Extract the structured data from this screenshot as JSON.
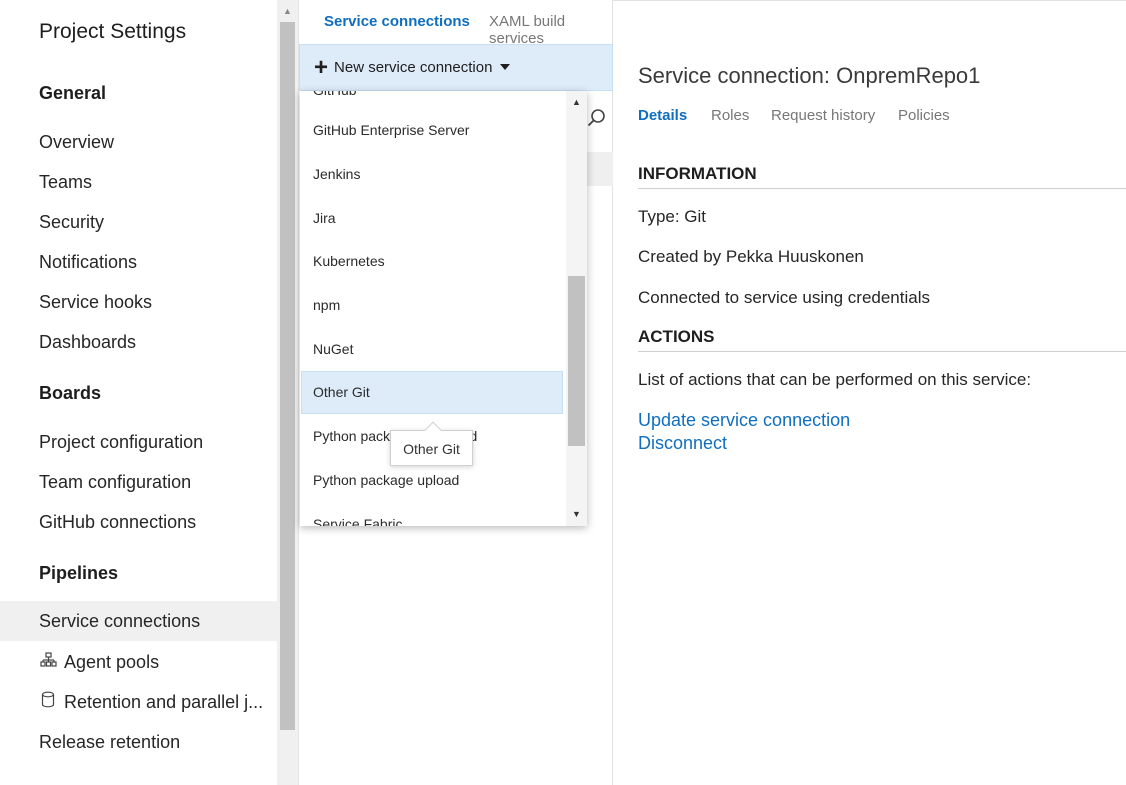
{
  "left_nav": {
    "title": "Project Settings",
    "sections": {
      "general": "General",
      "boards": "Boards",
      "pipelines": "Pipelines"
    },
    "general_items": [
      "Overview",
      "Teams",
      "Security",
      "Notifications",
      "Service hooks",
      "Dashboards"
    ],
    "boards_items": [
      "Project configuration",
      "Team configuration",
      "GitHub connections"
    ],
    "pipelines_items": [
      "Service connections",
      "Agent pools",
      "Retention and parallel j...",
      "Release retention"
    ],
    "selected_item": "Service connections"
  },
  "top_tabs": {
    "service_connections": "Service connections",
    "xaml": "XAML build services"
  },
  "new_button": {
    "label": "New service connection"
  },
  "dropdown": {
    "items": [
      "GitHub",
      "GitHub Enterprise Server",
      "Jenkins",
      "Jira",
      "Kubernetes",
      "npm",
      "NuGet",
      "Other Git",
      "Python package download",
      "Python package upload",
      "Service Fabric"
    ],
    "hovered": "Other Git"
  },
  "tooltip": {
    "text": "Other Git"
  },
  "detail": {
    "title": "Service connection: OnpremRepo1",
    "tabs": {
      "details": "Details",
      "roles": "Roles",
      "request_history": "Request history",
      "policies": "Policies"
    },
    "information_heading": "INFORMATION",
    "type_line": "Type: Git",
    "created_by": "Created by Pekka Huuskonen",
    "connected_line": "Connected to service using credentials",
    "actions_heading": "ACTIONS",
    "actions_desc": "List of actions that can be performed on this service:",
    "update_link": "Update service connection",
    "disconnect_link": "Disconnect"
  },
  "icons": {
    "agent_pools": "hierarchy-icon",
    "retention": "database-icon",
    "search": "search-icon"
  }
}
